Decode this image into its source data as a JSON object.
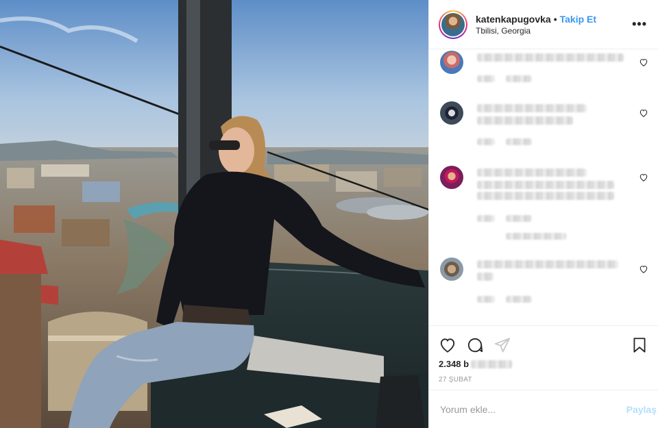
{
  "post": {
    "username": "katenkapugovka",
    "separator": "•",
    "follow_label": "Takip Et",
    "location": "Tbilisi, Georgia",
    "more_label": "•••",
    "likes_count": "2.348 b",
    "date": "27 ŞUBAT",
    "comment_placeholder": "Yorum ekle...",
    "share_label": "Paylaş"
  },
  "colors": {
    "link": "#3897f0",
    "share_disabled": "#b2dffc",
    "text": "#262626",
    "muted": "#999999"
  },
  "icons": [
    "more-icon",
    "heart-icon",
    "comment-icon",
    "share-icon",
    "bookmark-icon"
  ]
}
